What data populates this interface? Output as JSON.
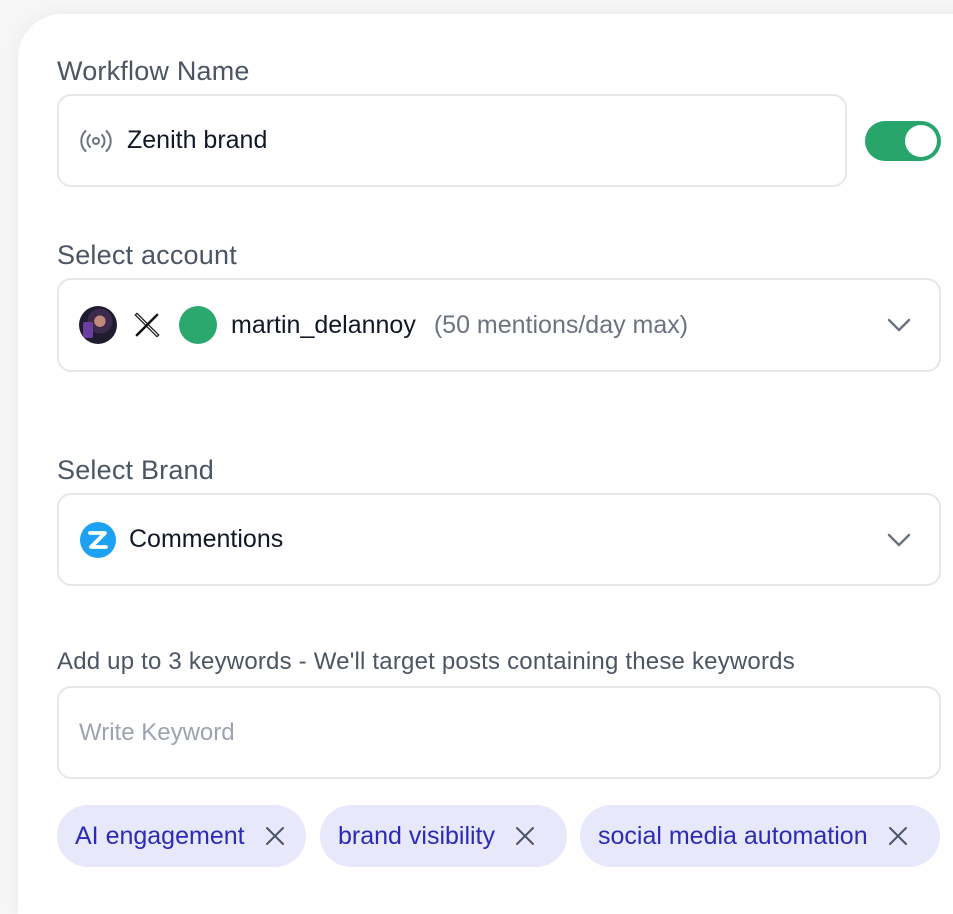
{
  "workflow": {
    "label": "Workflow Name",
    "name_value": "Zenith brand",
    "enabled": true,
    "toggle_color": "#27a56b"
  },
  "account": {
    "label": "Select account",
    "platform_icon": "x-logo-icon",
    "username": "martin_delannoy",
    "limit_text": "(50 mentions/day max)",
    "status_color": "#2aa86e"
  },
  "brand": {
    "label": "Select Brand",
    "icon": "commentions-logo-icon",
    "selected": "Commentions",
    "icon_color": "#1da1f2"
  },
  "keywords": {
    "label": "Add up to 3 keywords - We'll target posts containing these keywords",
    "placeholder": "Write Keyword",
    "chips": [
      {
        "label": "AI engagement"
      },
      {
        "label": "brand visibility"
      },
      {
        "label": "social media automation"
      }
    ],
    "chip_bg": "#e8e8fb",
    "chip_text": "#2b2bb5"
  }
}
